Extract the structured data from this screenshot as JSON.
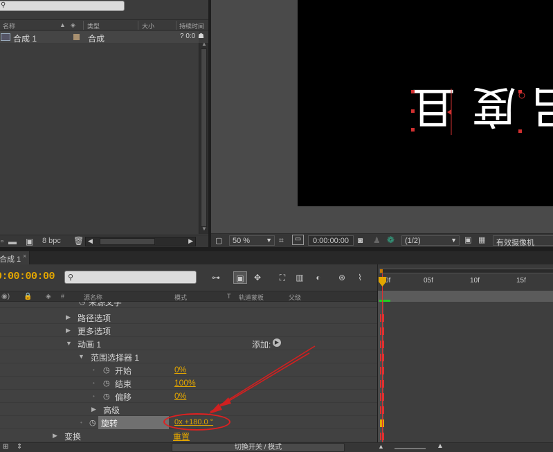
{
  "project": {
    "search_placeholder": "",
    "columns": [
      "名称",
      "类型",
      "大小",
      "持续时间"
    ],
    "items": [
      {
        "name": "合成 1",
        "type": "合成",
        "duration": "? 0:0"
      }
    ],
    "bit_depth": "8 bpc"
  },
  "viewer": {
    "zoom": "50 %",
    "timecode": "0:00:00:00",
    "resolution": "(1/2)",
    "camera": "有效摄像机",
    "canvas_chars": [
      "且",
      "度",
      "吕"
    ]
  },
  "timeline": {
    "tab_label": "合成 1",
    "timecode": "0:00:00:00",
    "columns": {
      "source_name": "源名称",
      "mode": "模式",
      "t": "T",
      "track_matte": "轨道蒙板",
      "parent": "父级",
      "hash": "#"
    },
    "ruler_ticks": [
      "0f",
      "05f",
      "10f",
      "15f"
    ],
    "rows": [
      {
        "name": "来源文字",
        "indent": 1
      },
      {
        "name": "路径选项"
      },
      {
        "name": "更多选项"
      },
      {
        "name": "动画 1",
        "add_label": "添加:"
      },
      {
        "name": "范围选择器 1"
      },
      {
        "name": "开始",
        "value": "0%"
      },
      {
        "name": "结束",
        "value": "100%"
      },
      {
        "name": "偏移",
        "value": "0%"
      },
      {
        "name": "高级"
      },
      {
        "name": "旋转",
        "value": "0x +180.0 °"
      },
      {
        "name": "变换",
        "value": "重置"
      }
    ],
    "toggle_label": "切换开关 / 模式"
  },
  "colors": {
    "accent": "#e3a600",
    "annotation": "#e02020"
  }
}
